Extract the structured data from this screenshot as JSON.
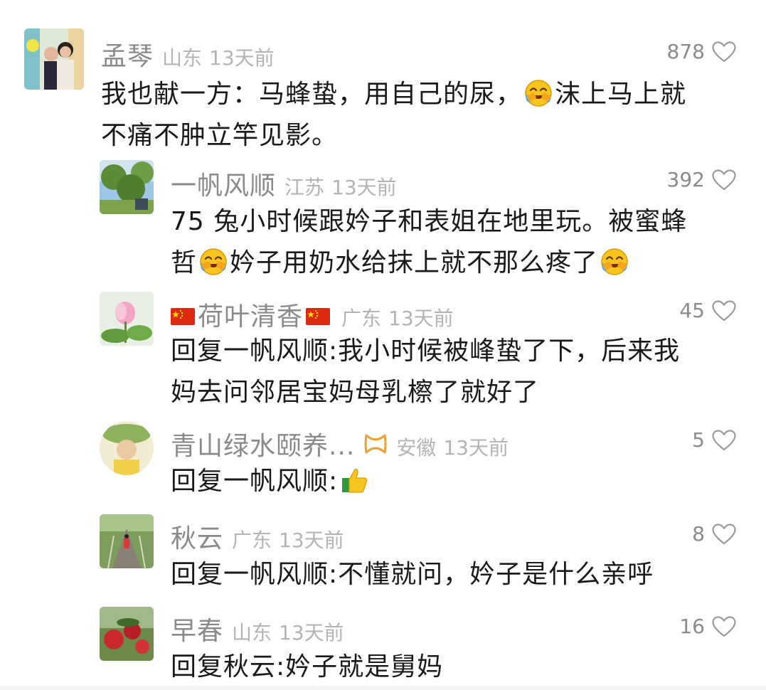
{
  "comments": [
    {
      "user": "孟琴",
      "region": "山东",
      "time": "13天前",
      "likes": "878",
      "text_a": "我也献一方：马蜂蛰，用自己的尿，",
      "text_b": "沫上马上就",
      "text_c": "不痛不肿立竿见影。",
      "icons": [
        "cry-laughing-emoji",
        "heart-icon"
      ]
    },
    {
      "user": "一帆风顺",
      "region": "江苏",
      "time": "13天前",
      "likes": "392",
      "text_a": "75 兔小时候跟妗子和表姐在地里玩。被蜜蜂",
      "text_b": "哲",
      "text_c": "妗子用奶水给抹上就不那么疼了",
      "icons": [
        "cry-laughing-emoji",
        "heart-icon"
      ]
    },
    {
      "user": "荷叶清香",
      "region": "广东",
      "time": "13天前",
      "likes": "45",
      "text_a": "回复一帆风顺:我小时候被峰蛰了下，后来我",
      "text_b": "妈去问邻居宝妈母乳檫了就好了",
      "icons": [
        "china-flag-icon",
        "heart-icon"
      ]
    },
    {
      "user": "青山绿水颐养...",
      "region": "安徽",
      "time": "13天前",
      "likes": "5",
      "text_a": "回复一帆风顺:",
      "icons": [
        "ribbon-badge-icon",
        "thumbs-up-emoji",
        "heart-icon"
      ]
    },
    {
      "user": "秋云",
      "region": "广东",
      "time": "13天前",
      "likes": "8",
      "text_a": "回复一帆风顺:不懂就问，妗子是什么亲呼",
      "icons": [
        "heart-icon"
      ]
    },
    {
      "user": "早春",
      "region": "山东",
      "time": "13天前",
      "likes": "16",
      "text_a": "回复秋云:妗子就是舅妈",
      "icons": [
        "heart-icon"
      ]
    }
  ],
  "colors": {
    "username": "#8a8a8a",
    "meta": "#b4b4b4",
    "text": "#1a1a1a",
    "badge": "#f0a030"
  }
}
